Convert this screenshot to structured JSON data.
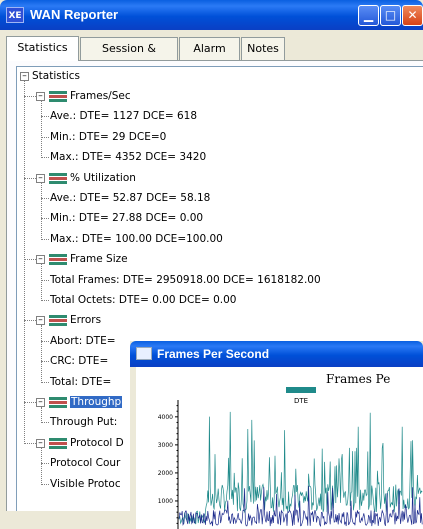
{
  "window": {
    "title": "WAN Reporter",
    "icon": "xe-app-icon",
    "buttons": [
      "minimize-icon",
      "maximize-icon",
      "close-icon"
    ]
  },
  "tabs": [
    "Statistics",
    "Session & Config",
    "Alarm Log",
    "Notes"
  ],
  "active_tab": "Statistics",
  "tree": {
    "root": "Statistics",
    "groups": [
      {
        "label": "Frames/Sec",
        "items": [
          "Ave.: DTE= 1127 DCE= 618",
          "Min.: DTE= 29 DCE=0",
          "Max.: DTE= 4352 DCE= 3420"
        ]
      },
      {
        "label": "% Utilization",
        "items": [
          "Ave.: DTE= 52.87 DCE= 58.18",
          "Min.: DTE= 27.88 DCE= 0.00",
          "Max.: DTE= 100.00 DCE=100.00"
        ]
      },
      {
        "label": "Frame Size",
        "items": [
          "Total Frames: DTE= 2950918.00 DCE= 1618182.00",
          "Total Octets: DTE= 0.00 DCE= 0.00"
        ]
      },
      {
        "label": "Errors",
        "items": [
          "Abort: DTE=",
          "CRC: DTE=",
          "Total: DTE="
        ]
      },
      {
        "label": "Throughp",
        "selected": true,
        "items": [
          "Through Put:"
        ]
      },
      {
        "label": "Protocol D",
        "items": [
          "Protocol Cour",
          "Visible Protoc"
        ]
      }
    ],
    "node_icon_colors": [
      "#2e8b6f",
      "#c0504d",
      "#2e8b6f"
    ]
  },
  "chart_window": {
    "title": "Frames Per Second",
    "icon": "chart-window-icon"
  },
  "chart_data": {
    "type": "line",
    "title": "Frames Pe",
    "legend": [
      {
        "name": "DTE",
        "color": "#1f8a8a"
      }
    ],
    "yticks": [
      1000,
      2000,
      3000,
      4000
    ],
    "ylim": [
      0,
      4600
    ],
    "series": [
      {
        "name": "DTE",
        "color": "#1f8a8a"
      },
      {
        "name": "",
        "color": "#1c2a8c"
      }
    ]
  }
}
